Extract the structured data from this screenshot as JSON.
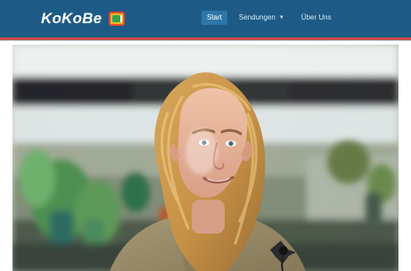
{
  "brand": {
    "name": "KoKoBe",
    "logo_icon": "tv-icon"
  },
  "nav": {
    "items": [
      {
        "label": "Start",
        "active": true
      },
      {
        "label": "Sendungen",
        "has_dropdown": true
      },
      {
        "label": "Über Uns"
      }
    ]
  },
  "colors": {
    "header_bg": "#1d5b86",
    "active_tab_bg": "#2f75a7",
    "accent_red": "#c84c43"
  },
  "hero": {
    "image_name": "portrait-photo"
  }
}
